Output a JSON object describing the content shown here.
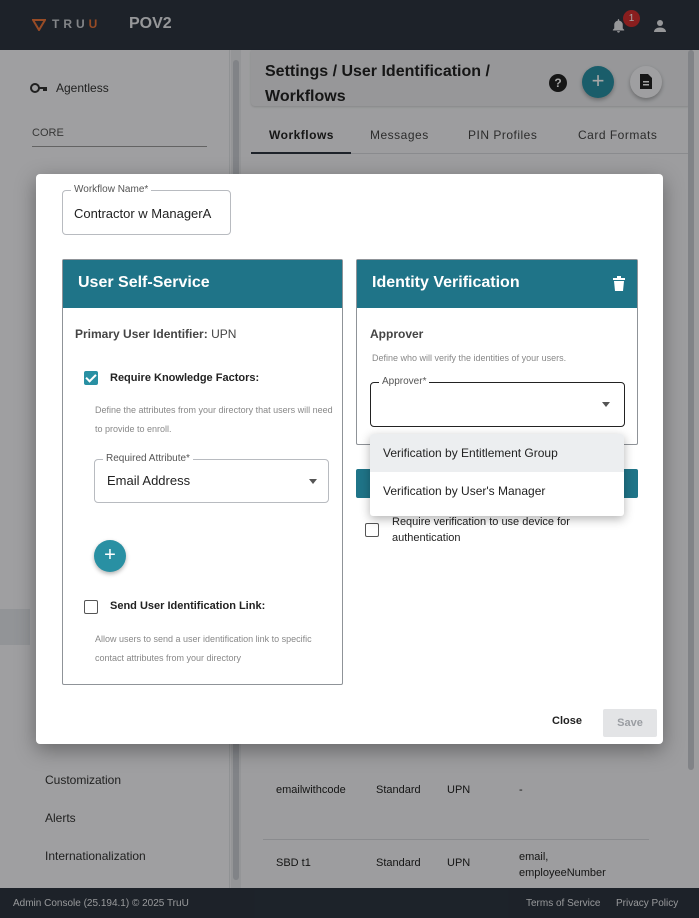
{
  "header": {
    "logo_text_prefix": "TRU",
    "logo_text_suffix": "U",
    "app_name": "POV2",
    "notification_count": "1"
  },
  "sidebar": {
    "agentless_label": "Agentless",
    "section_label": "CORE",
    "items": [
      {
        "label": "Customization"
      },
      {
        "label": "Alerts"
      },
      {
        "label": "Internationalization"
      }
    ]
  },
  "page": {
    "title": "Settings / User Identification / Workflows",
    "help_glyph": "?",
    "add_glyph": "+",
    "tabs": [
      "Workflows",
      "Messages",
      "PIN Profiles",
      "Card Formats"
    ],
    "rows": [
      {
        "name": "emailwithcode",
        "type": "Standard",
        "identifier": "UPN",
        "attributes": "-"
      },
      {
        "name": "SBD t1",
        "type": "Standard",
        "identifier": "UPN",
        "attributes": "email,\nemployeeNumber"
      }
    ]
  },
  "modal": {
    "workflow_name_label": "Workflow Name*",
    "workflow_name_value": "Contractor w ManagerA",
    "self_service": {
      "title": "User Self-Service",
      "primary_identifier_label": "Primary User Identifier:",
      "primary_identifier_value": "UPN",
      "knowledge_factors_label": "Require Knowledge Factors:",
      "knowledge_factors_checked": true,
      "knowledge_factors_help": "Define the attributes from your directory that users will need to provide to enroll.",
      "required_attribute_label": "Required Attribute*",
      "required_attribute_value": "Email Address",
      "add_glyph": "+",
      "send_link_label": "Send User Identification Link:",
      "send_link_checked": false,
      "send_link_help": "Allow users to send a user identification link to specific contact attributes from your directory"
    },
    "identity_verification": {
      "title": "Identity Verification",
      "approver_title": "Approver",
      "approver_help": "Define who will verify the identities of your users.",
      "approver_field_label": "Approver*",
      "approver_value": "",
      "options": [
        "Verification by Entitlement Group",
        "Verification by User's Manager"
      ],
      "device_verification_label": "Require verification to use device for authentication",
      "device_verification_checked": false
    },
    "close_label": "Close",
    "save_label": "Save"
  },
  "footer": {
    "version": "Admin Console (25.194.1) © 2025 TruU",
    "terms": "Terms of Service",
    "privacy": "Privacy Policy"
  },
  "colors": {
    "topbar": "#2d3540",
    "accent_teal": "#2990a3",
    "card_header": "#1f7488",
    "logo_accent": "#e8733a",
    "badge": "#d32f2f"
  }
}
